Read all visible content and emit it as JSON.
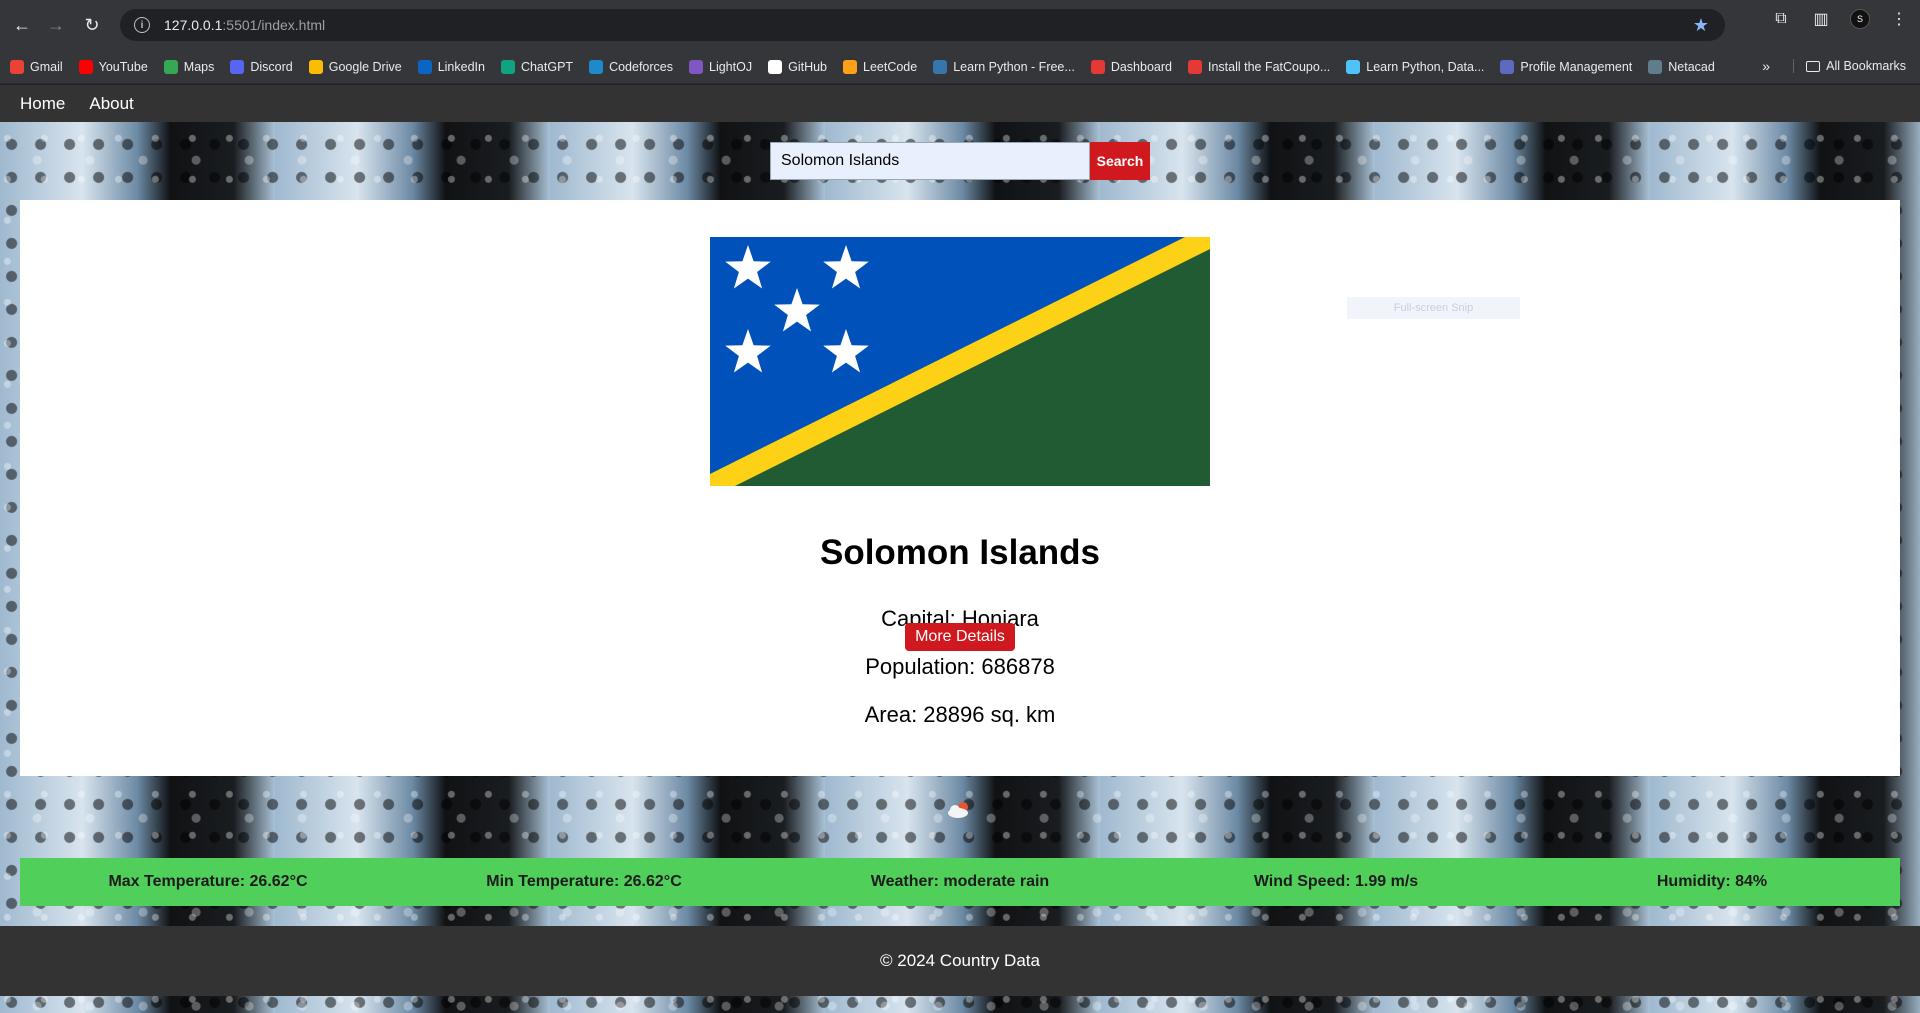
{
  "browser": {
    "url_host": "127.0.0.1",
    "url_rest": ":5501/index.html",
    "bookmarks": [
      "Gmail",
      "YouTube",
      "Maps",
      "Discord",
      "Google Drive",
      "LinkedIn",
      "ChatGPT",
      "Codeforces",
      "LightOJ",
      "GitHub",
      "LeetCode",
      "Learn Python - Free...",
      "Dashboard",
      "Install the FatCoupo...",
      "Learn Python, Data...",
      "Profile Management",
      "Netacad"
    ],
    "bookmark_colors": [
      "#ea4335",
      "#ff0000",
      "#34a853",
      "#5865f2",
      "#fbbc04",
      "#0a66c2",
      "#10a37f",
      "#1f8acb",
      "#7e57c2",
      "#ffffff",
      "#ffa116",
      "#3776ab",
      "#e53935",
      "#e53935",
      "#4fc3f7",
      "#5c6bc0",
      "#607d8b"
    ],
    "all_bookmarks": "All Bookmarks",
    "avatar_letter": "S"
  },
  "nav": {
    "home": "Home",
    "about": "About"
  },
  "search": {
    "value": "Solomon Islands",
    "button": "Search"
  },
  "country": {
    "name": "Solomon Islands",
    "capital": "Capital: Honiara",
    "population": "Population: 686878",
    "area": "Area: 28896 sq. km",
    "more_button": "More Details",
    "flag_colors": {
      "blue": "#0051ba",
      "yellow": "#fcd116",
      "green": "#215b33"
    }
  },
  "snip_overlay": "Full-screen Snip",
  "weather": {
    "max_temp": "Max Temperature: 26.62°C",
    "min_temp": "Min Temperature: 26.62°C",
    "condition": "Weather: moderate rain",
    "wind": "Wind Speed: 1.99 m/s",
    "humidity": "Humidity: 84%"
  },
  "footer": {
    "text": "© 2024 Country Data"
  }
}
